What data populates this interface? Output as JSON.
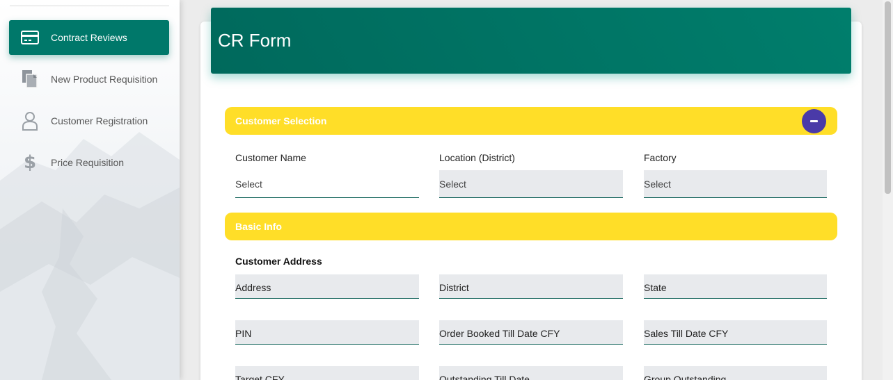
{
  "sidebar": {
    "items": [
      {
        "label": "Contract Reviews",
        "icon": "credit-card-icon",
        "active": true
      },
      {
        "label": "New Product Requisition",
        "icon": "documents-icon",
        "active": false
      },
      {
        "label": "Customer Registration",
        "icon": "user-icon",
        "active": false
      },
      {
        "label": "Price Requisition",
        "icon": "dollar-icon",
        "active": false
      }
    ]
  },
  "form": {
    "title": "CR Form",
    "customer_selection": {
      "heading": "Customer Selection",
      "fields": [
        {
          "label": "Customer Name",
          "placeholder": "Select"
        },
        {
          "label": "Location (District)",
          "placeholder": "Select"
        },
        {
          "label": "Factory",
          "placeholder": "Select"
        }
      ]
    },
    "basic_info": {
      "heading": "Basic Info",
      "address_heading": "Customer Address",
      "fields": [
        {
          "label": "Address"
        },
        {
          "label": "District"
        },
        {
          "label": "State"
        },
        {
          "label": "PIN"
        },
        {
          "label": "Order Booked Till Date CFY"
        },
        {
          "label": "Sales Till Date CFY"
        },
        {
          "label": "Target CFY"
        },
        {
          "label": "Outstanding Till Date"
        },
        {
          "label": "Group Outstanding"
        }
      ]
    }
  },
  "colors": {
    "primary": "#00786a",
    "section_bar": "#ffde28",
    "collapse_button": "#4a3aa8"
  }
}
